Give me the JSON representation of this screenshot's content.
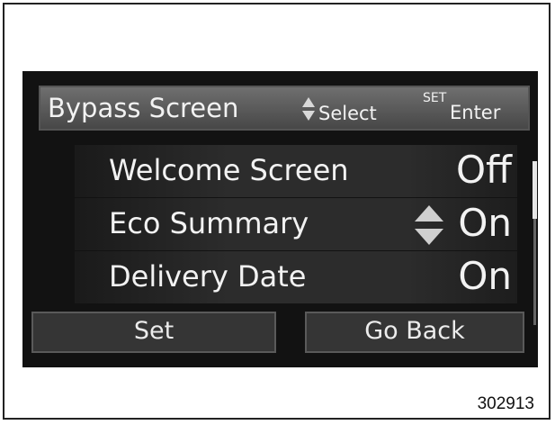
{
  "header": {
    "title": "Bypass Screen",
    "select_hint": "Select",
    "select_icon": "up-down-arrows-icon",
    "enter_key": "SET",
    "enter_hint": "Enter"
  },
  "settings": [
    {
      "label": "Welcome Screen",
      "value": "Off"
    },
    {
      "label": "Eco Summary",
      "value": "On",
      "selected": true
    },
    {
      "label": "Delivery Date",
      "value": "On"
    }
  ],
  "scroll": {
    "visible_fraction": 0.35,
    "position_fraction": 0.0
  },
  "buttons": {
    "set_label": "Set",
    "back_label": "Go Back"
  },
  "figure_number": "302913",
  "colors": {
    "screen_background": "#121212",
    "header_background": "#5a5a5a",
    "text": "#f2f2f2",
    "selection_arrows": "#cfcfcf"
  }
}
